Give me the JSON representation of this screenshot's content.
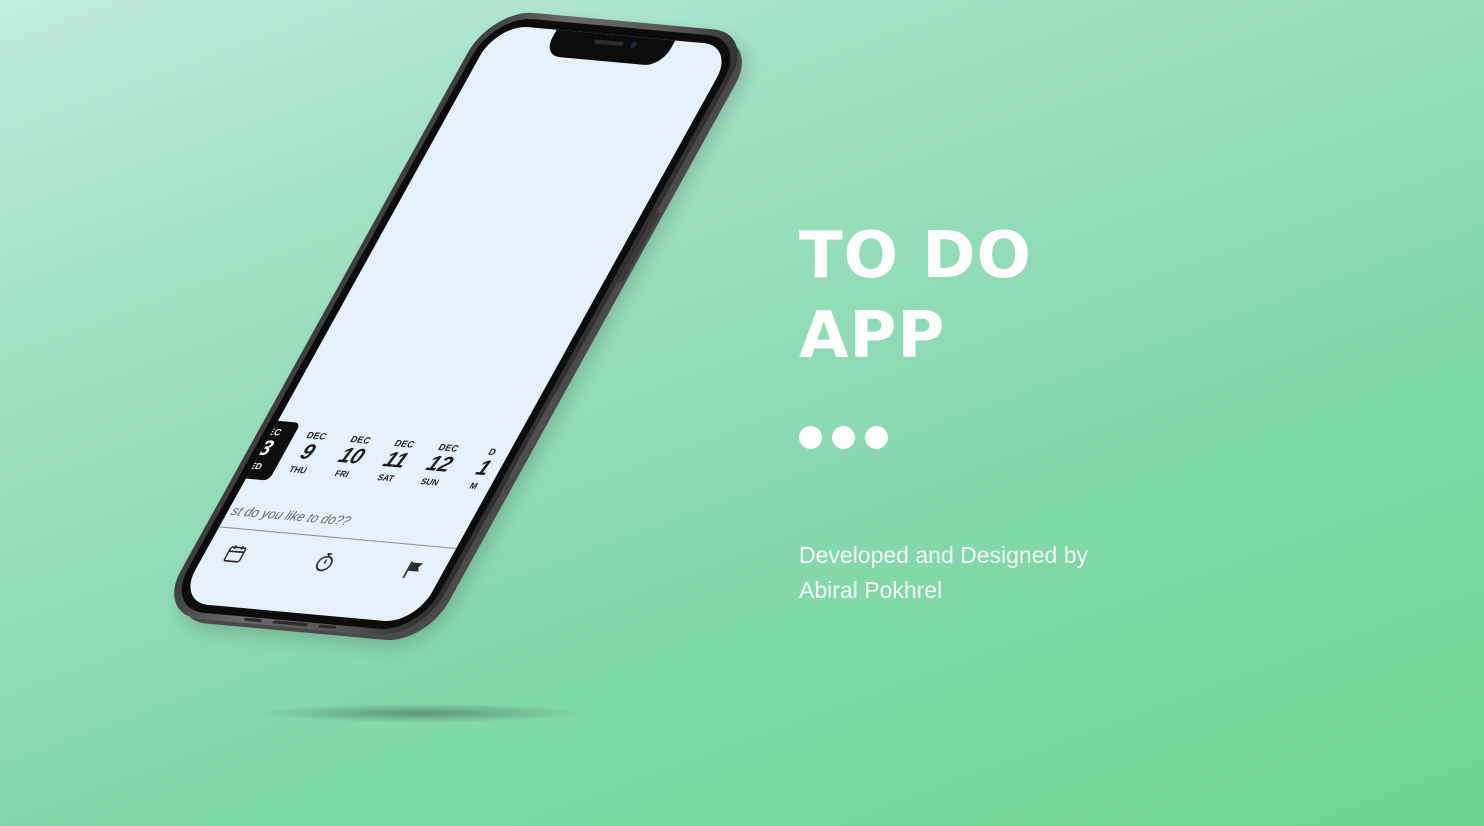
{
  "hero": {
    "title_line1": "TO DO",
    "title_line2": "APP",
    "credit_line1": "Developed and Designed by",
    "credit_line2": "Abiral Pokhrel"
  },
  "phone": {
    "date_strip": [
      {
        "mon": "EC",
        "day": "3",
        "dow": "ED",
        "selected": true
      },
      {
        "mon": "DEC",
        "day": "9",
        "dow": "THU",
        "selected": false
      },
      {
        "mon": "DEC",
        "day": "10",
        "dow": "FRI",
        "selected": false
      },
      {
        "mon": "DEC",
        "day": "11",
        "dow": "SAT",
        "selected": false
      },
      {
        "mon": "DEC",
        "day": "12",
        "dow": "SUN",
        "selected": false
      },
      {
        "mon": "D",
        "day": "1",
        "dow": "M",
        "selected": false
      }
    ],
    "task_prompt": "st do you like to do??",
    "bottom_nav": [
      {
        "icon": "calendar-icon"
      },
      {
        "icon": "timer-icon"
      },
      {
        "icon": "flag-icon"
      }
    ]
  },
  "colors": {
    "background_top": "#c3ecdf",
    "background_bottom": "#6cd38f",
    "screen": "#e5f1fb",
    "selected_date": "#0e0e0e",
    "text": "#ffffff"
  }
}
